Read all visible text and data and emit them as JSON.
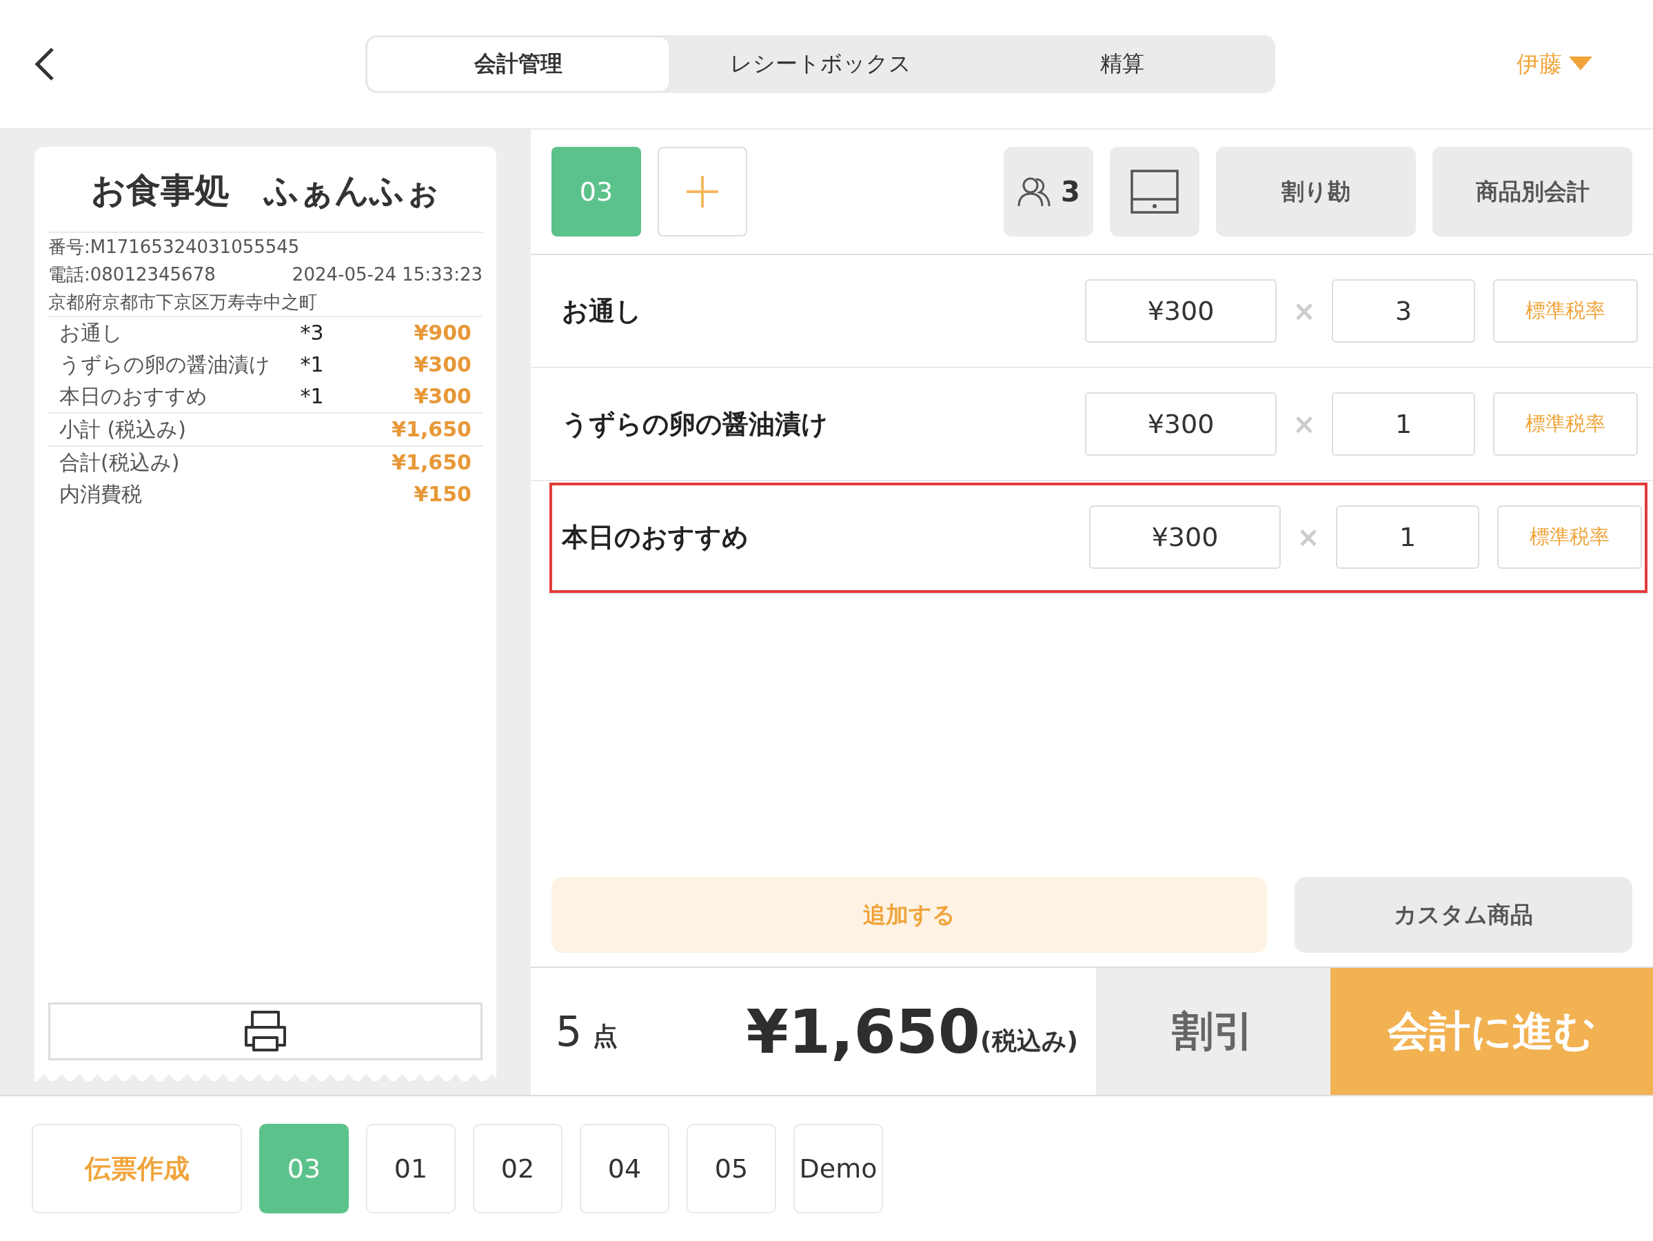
{
  "top_tabs": [
    {
      "label": "会計管理",
      "selected": true
    },
    {
      "label": "レシートボックス",
      "selected": false
    },
    {
      "label": "精算",
      "selected": false
    }
  ],
  "user": "伊藤",
  "receipt": {
    "shop": "お食事処　ふぁんふぉ",
    "number": "番号:M17165324031055545",
    "phone": "電話:08012345678",
    "datetime": "2024-05-24 15:33:23",
    "address": "京都府京都市下京区万寿寺中之町",
    "lines": [
      {
        "name": "お通し",
        "qty": "*3",
        "amount": "¥900"
      },
      {
        "name": "うずらの卵の醤油漬け",
        "qty": "*1",
        "amount": "¥300"
      },
      {
        "name": "本日のおすすめ",
        "qty": "*1",
        "amount": "¥300"
      }
    ],
    "subtotal": {
      "label": "小計 (税込み)",
      "amount": "¥1,650"
    },
    "totals": [
      {
        "label": "合計(税込み)",
        "amount": "¥1,650"
      },
      {
        "label": "内消費税",
        "amount": "¥150"
      }
    ]
  },
  "toolbar": {
    "table": "03",
    "guests": "3",
    "split": "割り勘",
    "by_item": "商品別会計"
  },
  "items": [
    {
      "name": "お通し",
      "price": "¥300",
      "times": "×",
      "qty": "3",
      "tax": "標準税率",
      "selected": false
    },
    {
      "name": "うずらの卵の醤油漬け",
      "price": "¥300",
      "times": "×",
      "qty": "1",
      "tax": "標準税率",
      "selected": false
    },
    {
      "name": "本日のおすすめ",
      "price": "¥300",
      "times": "×",
      "qty": "1",
      "tax": "標準税率",
      "selected": true
    }
  ],
  "add_button": "追加する",
  "custom_button": "カスタム商品",
  "summary": {
    "count": "5",
    "count_unit": "点",
    "total": "¥1,650",
    "tax_note": "(税込み)",
    "discount": "割引",
    "checkout": "会計に進む"
  },
  "bottom_tabs": [
    {
      "label": "伝票作成",
      "kind": "action",
      "selected": false
    },
    {
      "label": "03",
      "kind": "table",
      "selected": true
    },
    {
      "label": "01",
      "kind": "table",
      "selected": false
    },
    {
      "label": "02",
      "kind": "table",
      "selected": false
    },
    {
      "label": "04",
      "kind": "table",
      "selected": false
    },
    {
      "label": "05",
      "kind": "table",
      "selected": false
    },
    {
      "label": "Demo",
      "kind": "table",
      "selected": false
    }
  ]
}
